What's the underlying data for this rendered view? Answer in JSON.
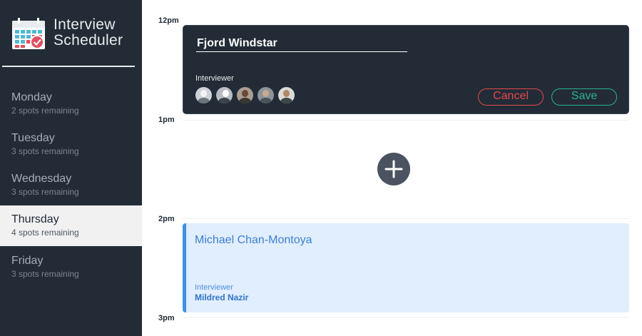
{
  "brand": {
    "line1": "Interview",
    "line2": "Scheduler",
    "logo_icon": "calendar-check-icon"
  },
  "days": [
    {
      "name": "Monday",
      "spots": "2 spots remaining",
      "selected": false
    },
    {
      "name": "Tuesday",
      "spots": "3 spots remaining",
      "selected": false
    },
    {
      "name": "Wednesday",
      "spots": "3 spots remaining",
      "selected": false
    },
    {
      "name": "Thursday",
      "spots": "4 spots remaining",
      "selected": true
    },
    {
      "name": "Friday",
      "spots": "3 spots remaining",
      "selected": false
    }
  ],
  "times": [
    "12pm",
    "1pm",
    "2pm",
    "3pm"
  ],
  "form": {
    "student_name": "Fjord Windstar",
    "interviewer_label": "Interviewer",
    "interviewers": [
      "interviewer-1",
      "interviewer-2",
      "interviewer-3",
      "interviewer-4",
      "interviewer-5"
    ],
    "cancel_label": "Cancel",
    "save_label": "Save"
  },
  "add": {
    "icon": "plus-icon"
  },
  "appointment": {
    "student": "Michael Chan-Montoya",
    "interviewer_label": "Interviewer",
    "interviewer_name": "Mildred Nazir"
  },
  "colors": {
    "sidebar": "#222b36",
    "selected_day": "#f1f1f1",
    "cancel": "#e4484b",
    "save": "#2bb395",
    "appointment_bg": "#e1eefe",
    "appointment_accent": "#3a92f0"
  }
}
